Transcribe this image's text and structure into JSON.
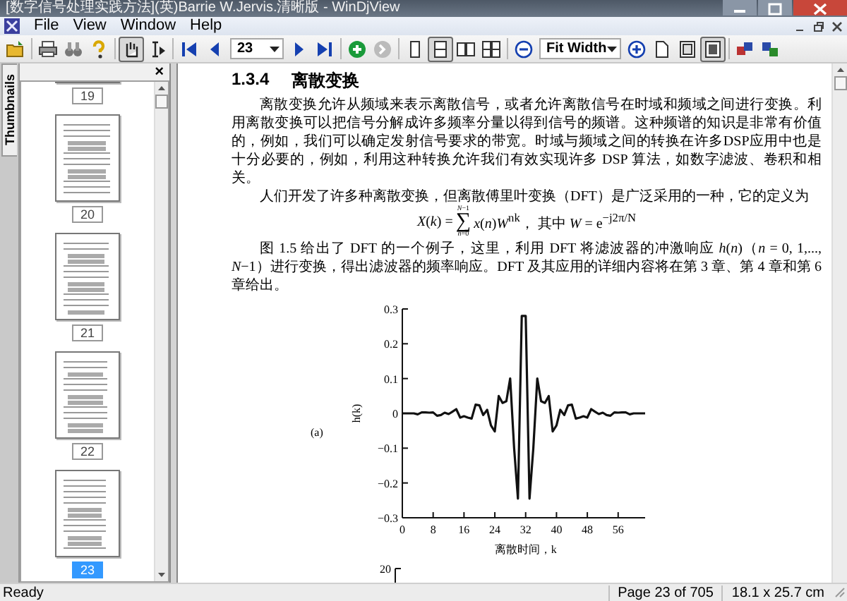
{
  "window": {
    "title": "[数字信号处理实践方法](英)Barrie W.Jervis.清晰版 - WinDjView"
  },
  "menu": [
    "File",
    "View",
    "Window",
    "Help"
  ],
  "toolbar": [
    {
      "kind": "open",
      "pressed": false
    },
    {
      "kind": "separator"
    },
    {
      "kind": "print",
      "pressed": false
    },
    {
      "kind": "find",
      "pressed": false
    },
    {
      "kind": "help",
      "pressed": false
    },
    {
      "kind": "separator"
    },
    {
      "kind": "hand",
      "pressed": true
    },
    {
      "kind": "select",
      "pressed": false
    },
    {
      "kind": "separator"
    },
    {
      "kind": "first",
      "pressed": false
    },
    {
      "kind": "prev",
      "pressed": false
    },
    {
      "kind": "page-combo",
      "value": "23"
    },
    {
      "kind": "next",
      "pressed": false
    },
    {
      "kind": "last",
      "pressed": false
    },
    {
      "kind": "separator"
    },
    {
      "kind": "forward",
      "pressed": false
    },
    {
      "kind": "back",
      "pressed": false
    },
    {
      "kind": "separator"
    },
    {
      "kind": "single",
      "pressed": false
    },
    {
      "kind": "continuous",
      "pressed": true
    },
    {
      "kind": "facing",
      "pressed": false
    },
    {
      "kind": "facing-continuous",
      "pressed": false
    },
    {
      "kind": "separator"
    },
    {
      "kind": "zoom-out",
      "pressed": false
    },
    {
      "kind": "zoom-combo",
      "value": "Fit Width"
    },
    {
      "kind": "zoom-in",
      "pressed": false
    },
    {
      "kind": "page",
      "pressed": false
    },
    {
      "kind": "fit-page",
      "pressed": false
    },
    {
      "kind": "fit-width",
      "pressed": true
    },
    {
      "kind": "separator"
    },
    {
      "kind": "layers",
      "pressed": false
    },
    {
      "kind": "swap",
      "pressed": false
    }
  ],
  "sidebar": {
    "tab": "Thumbnails",
    "close": "×",
    "thumbnails": [
      {
        "label": "19",
        "selected": false
      },
      {
        "label": "20",
        "selected": false
      },
      {
        "label": "21",
        "selected": false
      },
      {
        "label": "22",
        "selected": false
      },
      {
        "label": "23",
        "selected": true
      }
    ]
  },
  "document": {
    "heading": {
      "number": "1.3.4",
      "title": "离散变换"
    },
    "paragraphs": [
      "离散变换允许从频域来表示离散信号，或者允许离散信号在时域和频域之间进行变换。利用离散变换可以把信号分解成许多频率分量以得到信号的频谱。这种频谱的知识是非常有价值的，例如，我们可以确定发射信号要求的带宽。时域与频域之间的转换在许多DSP应用中也是十分必要的，例如，利用这种转换允许我们有效实现许多 DSP 算法，如数字滤波、卷积和相关。",
      "人们开发了许多种离散变换，但离散傅里叶变换（DFT）是广泛采用的一种，它的定义为"
    ],
    "formula": {
      "lhs": "*X*(*k*) =",
      "sum_top": "*N*−1",
      "sum_sign": "∑",
      "sum_bottom": "*n*=0",
      "rhs": "*x*(*n*)*W*$^{nk}$，  其中 *W* = e$^{−j2π/N}$"
    },
    "paragraphs_after": [
      "图 1.5 给出了 DFT 的一个例子，这里，利用 DFT 将滤波器的冲激响应 *h*(*n*)（*n* = 0, 1,..., *N*−1）进行变换，得出滤波器的频率响应。DFT 及其应用的详细内容将在第 3 章、第 4 章和第 6 章给出。"
    ],
    "figure": {
      "panel_label": "(a)",
      "chart_data": {
        "type": "line",
        "xlabel": "离散时间，k",
        "ylabel": "h(k)",
        "x": [
          0,
          1,
          2,
          3,
          4,
          5,
          6,
          7,
          8,
          9,
          10,
          11,
          12,
          13,
          14,
          15,
          16,
          17,
          18,
          19,
          20,
          21,
          22,
          23,
          24,
          25,
          26,
          27,
          28,
          29,
          30,
          31,
          32,
          33,
          34,
          35,
          36,
          37,
          38,
          39,
          40,
          41,
          42,
          43,
          44,
          45,
          46,
          47,
          48,
          49,
          50,
          51,
          52,
          53,
          54,
          55,
          56,
          57,
          58,
          59,
          60,
          61,
          62,
          63
        ],
        "series": [
          {
            "color": "#111111",
            "values": [
              0,
              0,
              0,
              0,
              -0.003,
              0.003,
              0.003,
              0.002,
              0.003,
              -0.007,
              -0.005,
              0.002,
              -0.002,
              0.005,
              0.012,
              -0.012,
              -0.008,
              -0.012,
              -0.015,
              0.025,
              0.023,
              -0.005,
              0.01,
              -0.035,
              -0.052,
              0.05,
              0.03,
              0.035,
              0.1,
              -0.1,
              -0.245,
              0.28,
              0.28,
              -0.245,
              -0.1,
              0.1,
              0.035,
              0.03,
              0.05,
              -0.052,
              -0.035,
              0.01,
              -0.005,
              0.023,
              0.025,
              -0.015,
              -0.012,
              -0.008,
              -0.012,
              0.012,
              0.005,
              -0.002,
              0.002,
              -0.005,
              -0.007,
              0.003,
              0.002,
              0.003,
              0.003,
              -0.003,
              0,
              0,
              0,
              0
            ]
          }
        ],
        "xlim": [
          0,
          63
        ],
        "ylim": [
          -0.3,
          0.3
        ],
        "xticks": [
          0,
          8,
          16,
          24,
          32,
          40,
          48,
          56
        ],
        "yticks": [
          {
            "value": 0.3,
            "label": "0.3"
          },
          {
            "value": 0.2,
            "label": "0.2"
          },
          {
            "value": 0.1,
            "label": "0.1"
          },
          {
            "value": 0,
            "label": "0"
          },
          {
            "value": -0.1,
            "label": "−0.1"
          },
          {
            "value": -0.2,
            "label": "−0.2"
          },
          {
            "value": -0.3,
            "label": "−0.3"
          }
        ]
      }
    },
    "figure_b": {
      "ytick": "20"
    }
  },
  "status_bar": {
    "message": "Ready",
    "page": "Page 23 of 705",
    "size": "18.1 x 25.7 cm"
  }
}
